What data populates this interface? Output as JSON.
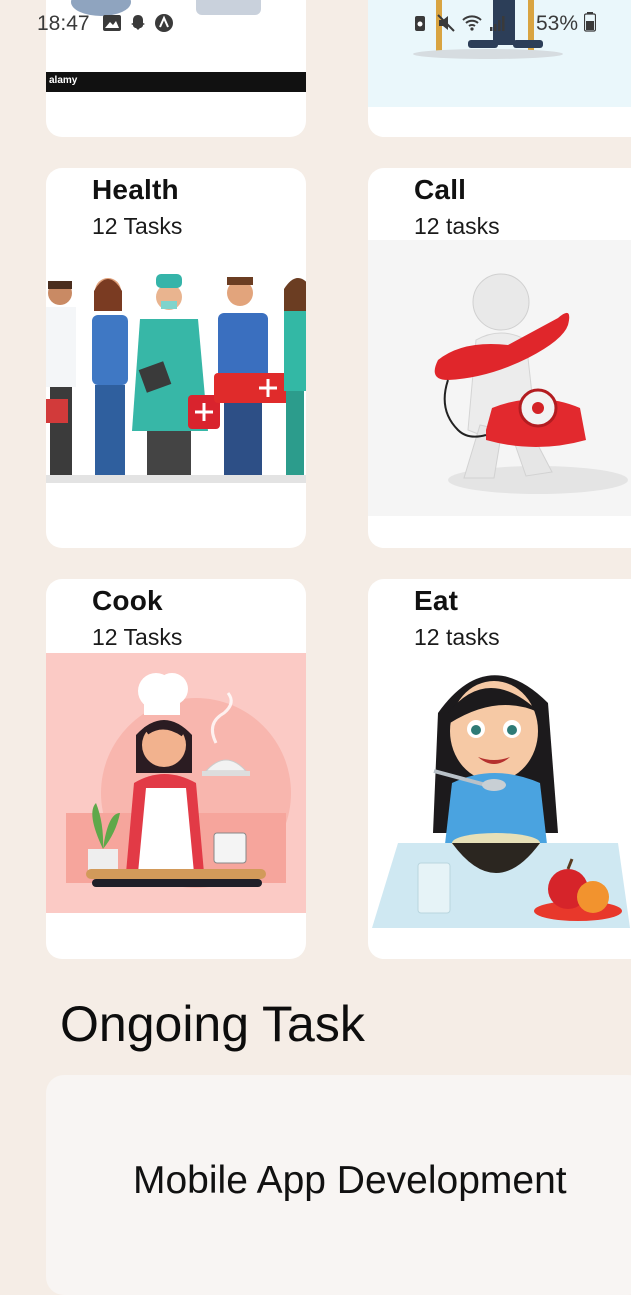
{
  "status_bar": {
    "time": "18:47",
    "battery": "53%"
  },
  "top_cards": {
    "left_watermark": "alamy"
  },
  "categories": [
    {
      "title": "Health",
      "subtitle": "12 Tasks",
      "image": "medical-staff-illustration"
    },
    {
      "title": "Call",
      "subtitle": "12 tasks",
      "image": "telephone-call-illustration"
    },
    {
      "title": "Cook",
      "subtitle": "12 Tasks",
      "image": "chef-cooking-illustration"
    },
    {
      "title": "Eat",
      "subtitle": "12 tasks",
      "image": "girl-eating-illustration"
    }
  ],
  "ongoing": {
    "section_title": "Ongoing Task",
    "task_label": "Mobile App Development"
  },
  "colors": {
    "background": "#f5ede6",
    "card": "#ffffff",
    "cook_bg": "#fbcac5",
    "call_bg": "#f4f4f4",
    "eat_table": "#cfe8f2"
  }
}
